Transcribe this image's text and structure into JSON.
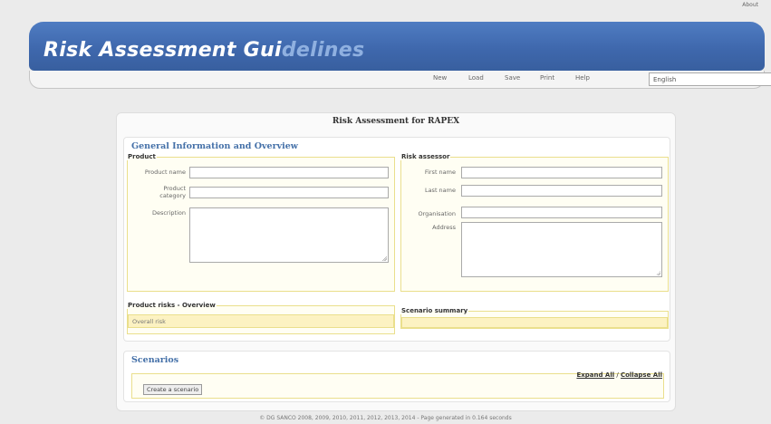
{
  "header": {
    "about": "About",
    "title_main": "Risk Assessment Gui",
    "title_faded": "delines"
  },
  "menu": {
    "items": [
      "New",
      "Load",
      "Save",
      "Print",
      "Help"
    ],
    "language": "English"
  },
  "page": {
    "title": "Risk Assessment for RAPEX"
  },
  "general": {
    "heading": "General Information and Overview",
    "product": {
      "legend": "Product",
      "name_label": "Product name",
      "category_label_1": "Product",
      "category_label_2": "category",
      "description_label": "Description",
      "name_value": "",
      "category_value": "",
      "description_value": ""
    },
    "assessor": {
      "legend": "Risk assessor",
      "first_name_label": "First name",
      "last_name_label": "Last name",
      "organisation_label": "Organisation",
      "address_label": "Address",
      "first_name_value": "",
      "last_name_value": "",
      "organisation_value": "",
      "address_value": ""
    },
    "risks": {
      "legend": "Product risks - Overview",
      "overall": "Overall risk"
    },
    "summary": {
      "legend": "Scenario summary"
    }
  },
  "scenarios": {
    "heading": "Scenarios",
    "expand_all": "Expand All",
    "separator": "/",
    "collapse_all": "Collapse All",
    "create_button": "Create a scenario"
  },
  "footer": {
    "text": "© DG SANCO 2008, 2009, 2010, 2011, 2012, 2013, 2014 - Page generated in 0.164 seconds"
  },
  "colors": {
    "banner": "#4674bb",
    "heading": "#4470a8",
    "field_border": "#eadf8c",
    "field_fill": "#fcf2c2"
  }
}
